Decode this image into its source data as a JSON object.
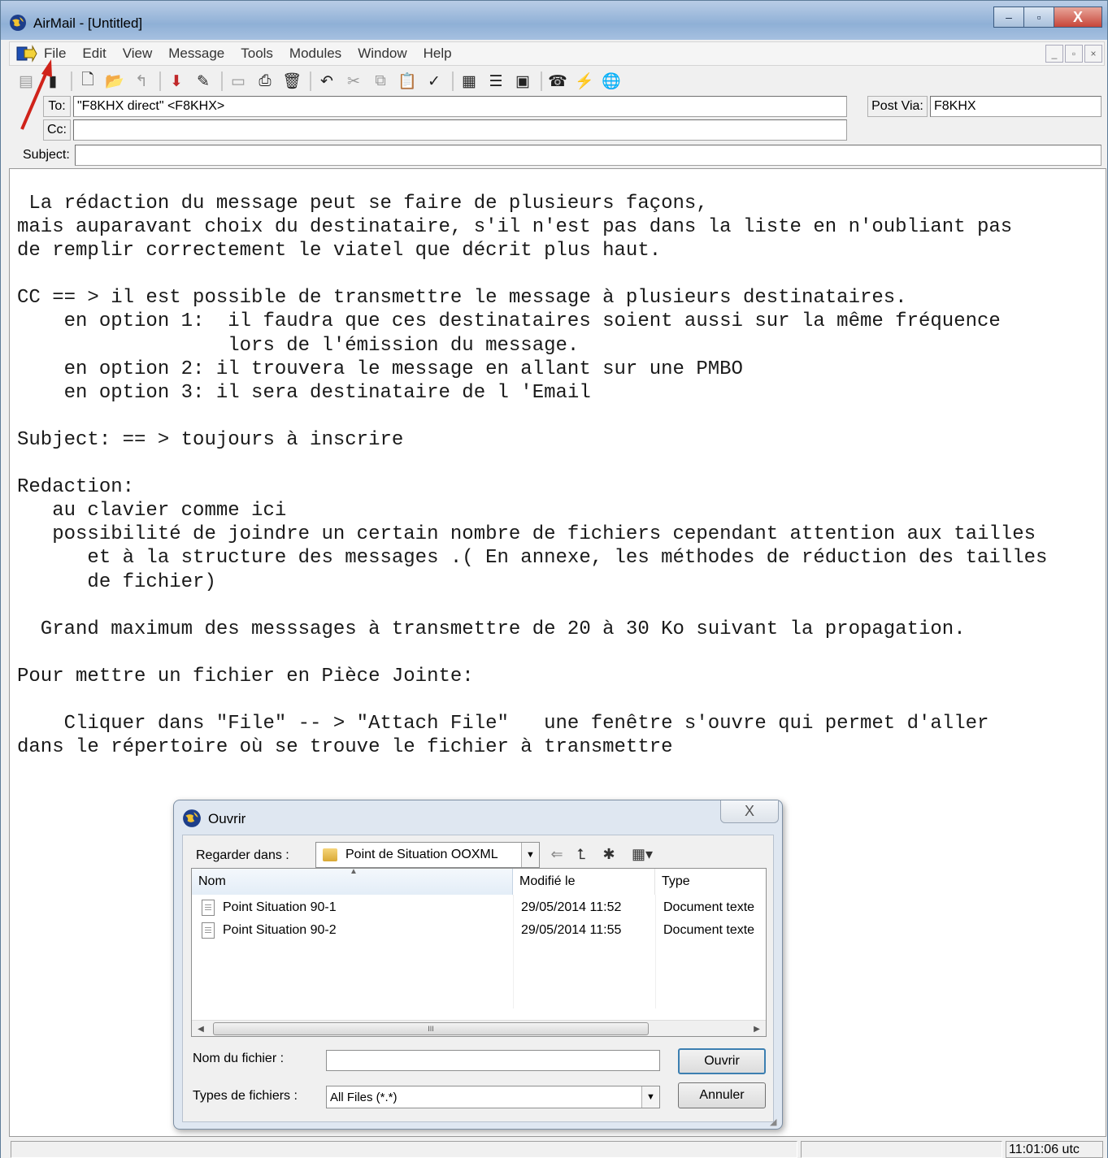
{
  "window": {
    "title": "AirMail - [Untitled]",
    "minimize": "–",
    "maximize": "▫",
    "close": "X"
  },
  "menubar": {
    "items": [
      "File",
      "Edit",
      "View",
      "Message",
      "Tools",
      "Modules",
      "Window",
      "Help"
    ],
    "mdi_minimize": "_",
    "mdi_restore": "▫",
    "mdi_close": "×"
  },
  "header": {
    "to_label": "To:",
    "to_value": "\"F8KHX direct\" <F8KHX>",
    "cc_label": "Cc:",
    "cc_value": "",
    "subject_label": "Subject:",
    "subject_value": "",
    "post_via_label": "Post Via:",
    "post_via_value": "F8KHX"
  },
  "body": {
    "text": " La rédaction du message peut se faire de plusieurs façons,\nmais auparavant choix du destinataire, s'il n'est pas dans la liste en n'oubliant pas\nde remplir correctement le viatel que décrit plus haut.\n\nCC == > il est possible de transmettre le message à plusieurs destinataires.\n    en option 1:  il faudra que ces destinataires soient aussi sur la même fréquence\n                  lors de l'émission du message.\n    en option 2: il trouvera le message en allant sur une PMBO\n    en option 3: il sera destinataire de l 'Email\n\nSubject: == > toujours à inscrire\n\nRedaction:\n   au clavier comme ici\n   possibilité de joindre un certain nombre de fichiers cependant attention aux tailles\n      et à la structure des messages .( En annexe, les méthodes de réduction des tailles\n      de fichier)\n\n  Grand maximum des messsages à transmettre de 20 à 30 Ko suivant la propagation.\n\nPour mettre un fichier en Pièce Jointe:\n\n    Cliquer dans \"File\" -- > \"Attach File\"   une fenêtre s'ouvre qui permet d'aller\ndans le répertoire où se trouve le fichier à transmettre"
  },
  "dialog": {
    "title": "Ouvrir",
    "close": "X",
    "look_in_label": "Regarder dans :",
    "look_in_value": "Point de Situation OOXML",
    "columns": {
      "name": "Nom",
      "modified": "Modifié le",
      "type": "Type"
    },
    "files": [
      {
        "name": "Point Situation 90-1",
        "modified": "29/05/2014 11:52",
        "type": "Document texte"
      },
      {
        "name": "Point Situation 90-2",
        "modified": "29/05/2014 11:55",
        "type": "Document texte"
      }
    ],
    "scroll_grip": "III",
    "filename_label": "Nom du fichier :",
    "filename_value": "",
    "filetype_label": "Types de fichiers :",
    "filetype_value": "All Files (*.*)",
    "open_button": "Ouvrir",
    "cancel_button": "Annuler"
  },
  "statusbar": {
    "clock": "11:01:06 utc"
  },
  "colors": {
    "accent_arrow": "#d0231a",
    "spell_underline": "#c0392b"
  }
}
